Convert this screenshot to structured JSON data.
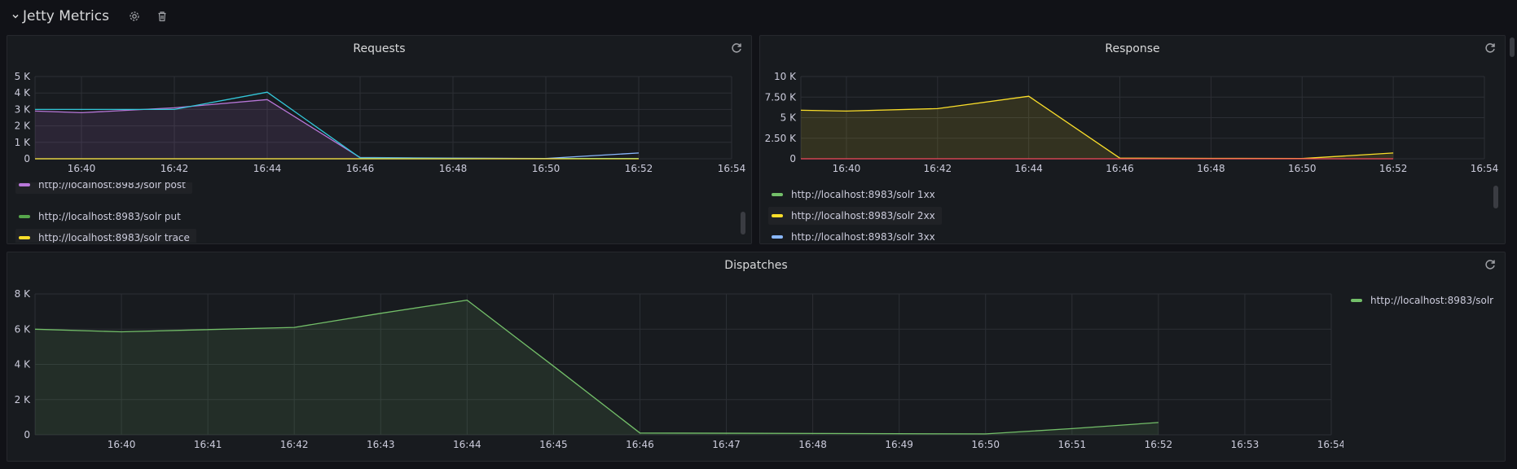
{
  "row": {
    "title": "Jetty Metrics",
    "icons": [
      "chevron-down-icon",
      "gear-icon",
      "trash-icon"
    ]
  },
  "colors": {
    "purple": "#b877d9",
    "cyan": "#33c7d9",
    "green": "#73bf69",
    "yellow": "#fade2a",
    "red": "#f2495c",
    "blue": "#8ab8ff"
  },
  "panels": {
    "requests": {
      "title": "Requests",
      "legend": [
        {
          "label": "http://localhost:8983/solr post",
          "color": "#b877d9"
        },
        {
          "label": "http://localhost:8983/solr put",
          "color": "#56a64b"
        },
        {
          "label": "http://localhost:8983/solr trace",
          "color": "#fade2a"
        }
      ]
    },
    "response": {
      "title": "Response",
      "legend": [
        {
          "label": "http://localhost:8983/solr 1xx",
          "color": "#73bf69"
        },
        {
          "label": "http://localhost:8983/solr 2xx",
          "color": "#fade2a"
        },
        {
          "label": "http://localhost:8983/solr 3xx",
          "color": "#8ab8ff"
        }
      ]
    },
    "dispatches": {
      "title": "Dispatches",
      "legend": [
        {
          "label": "http://localhost:8983/solr",
          "color": "#73bf69"
        }
      ]
    }
  },
  "chart_data": [
    {
      "type": "line",
      "title": "Requests",
      "ylim": [
        0,
        5000
      ],
      "yticks": [
        "0",
        "1 K",
        "2 K",
        "3 K",
        "4 K",
        "5 K"
      ],
      "xticks": [
        "16:40",
        "16:42",
        "16:44",
        "16:46",
        "16:48",
        "16:50",
        "16:52",
        "16:54"
      ],
      "xlim": [
        "16:39",
        "16:54"
      ],
      "series": [
        {
          "name": "http://localhost:8983/solr post",
          "color": "#b877d9",
          "fill": true,
          "points": [
            [
              "16:39",
              2900
            ],
            [
              "16:40",
              2800
            ],
            [
              "16:42",
              3100
            ],
            [
              "16:44",
              3600
            ],
            [
              "16:46",
              80
            ],
            [
              "16:48",
              40
            ],
            [
              "16:50",
              20
            ],
            [
              "16:52",
              20
            ]
          ]
        },
        {
          "color": "#33c7d9",
          "fill": false,
          "points": [
            [
              "16:39",
              3000
            ],
            [
              "16:40",
              3000
            ],
            [
              "16:42",
              3000
            ],
            [
              "16:44",
              4050
            ],
            [
              "16:46",
              60
            ],
            [
              "16:48",
              30
            ],
            [
              "16:50",
              15
            ],
            [
              "16:52",
              15
            ]
          ]
        },
        {
          "color": "#8ab8ff",
          "fill": false,
          "points": [
            [
              "16:39",
              0
            ],
            [
              "16:44",
              0
            ],
            [
              "16:46",
              0
            ],
            [
              "16:48",
              0
            ],
            [
              "16:50",
              20
            ],
            [
              "16:52",
              350
            ]
          ]
        },
        {
          "name": "http://localhost:8983/solr trace",
          "color": "#fade2a",
          "fill": false,
          "points": [
            [
              "16:39",
              0
            ],
            [
              "16:52",
              0
            ]
          ]
        }
      ],
      "grid": true,
      "legend_position": "bottom"
    },
    {
      "type": "line",
      "title": "Response",
      "ylim": [
        0,
        10000
      ],
      "yticks": [
        "0",
        "2.50 K",
        "5 K",
        "7.50 K",
        "10 K"
      ],
      "xticks": [
        "16:40",
        "16:42",
        "16:44",
        "16:46",
        "16:48",
        "16:50",
        "16:52",
        "16:54"
      ],
      "xlim": [
        "16:39",
        "16:54"
      ],
      "series": [
        {
          "name": "http://localhost:8983/solr 2xx",
          "color": "#fade2a",
          "fill": true,
          "points": [
            [
              "16:39",
              5900
            ],
            [
              "16:40",
              5800
            ],
            [
              "16:42",
              6100
            ],
            [
              "16:44",
              7600
            ],
            [
              "16:46",
              80
            ],
            [
              "16:48",
              50
            ],
            [
              "16:50",
              30
            ],
            [
              "16:52",
              700
            ]
          ]
        },
        {
          "color": "#f2495c",
          "fill": false,
          "points": [
            [
              "16:39",
              0
            ],
            [
              "16:52",
              0
            ]
          ]
        }
      ],
      "grid": true,
      "legend_position": "bottom"
    },
    {
      "type": "area",
      "title": "Dispatches",
      "ylim": [
        0,
        8000
      ],
      "yticks": [
        "0",
        "2 K",
        "4 K",
        "6 K",
        "8 K"
      ],
      "xticks": [
        "16:40",
        "16:41",
        "16:42",
        "16:43",
        "16:44",
        "16:45",
        "16:46",
        "16:47",
        "16:48",
        "16:49",
        "16:50",
        "16:51",
        "16:52",
        "16:53",
        "16:54"
      ],
      "xlim": [
        "16:39",
        "16:54"
      ],
      "series": [
        {
          "name": "http://localhost:8983/solr",
          "color": "#73bf69",
          "fill": true,
          "points": [
            [
              "16:39",
              6000
            ],
            [
              "16:40",
              5850
            ],
            [
              "16:42",
              6100
            ],
            [
              "16:43",
              6900
            ],
            [
              "16:44",
              7650
            ],
            [
              "16:45",
              3900
            ],
            [
              "16:46",
              100
            ],
            [
              "16:50",
              50
            ],
            [
              "16:51",
              350
            ],
            [
              "16:52",
              700
            ]
          ]
        }
      ],
      "grid": true,
      "legend_position": "right"
    }
  ]
}
